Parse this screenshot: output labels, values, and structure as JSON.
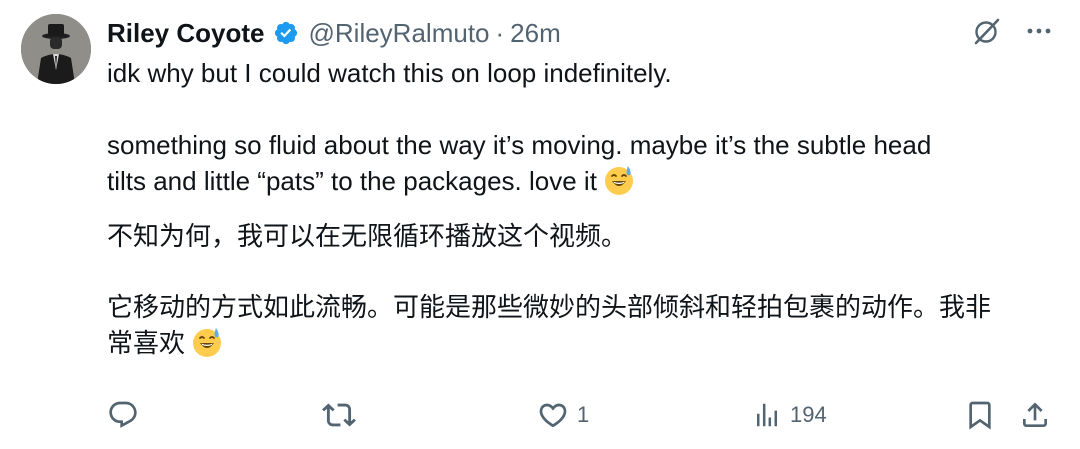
{
  "tweet": {
    "author": {
      "name": "Riley Coyote",
      "handle": "@RileyRalmuto",
      "separator": "·",
      "time": "26m",
      "avatar_icon": "avatar-figure-in-hat"
    },
    "verified_icon": "verified-badge-icon",
    "colors": {
      "accent": "#1d9bf0",
      "secondary_text": "#536471",
      "text": "#0f1419"
    },
    "lines": [
      "idk why but I could watch this on loop indefinitely.",
      "something so fluid about the way it’s moving. maybe it’s the subtle head",
      "tilts and little “pats” to the packages. love it",
      "不知为何，我可以在无限循环播放这个视频。",
      "它移动的方式如此流畅。可能是那些微妙的头部倾斜和轻拍包裹的动作。我非",
      "常喜欢"
    ],
    "emoji_icon": "grinning-face-with-sweat-emoji",
    "actions": {
      "reply": {
        "icon": "reply-icon",
        "count": ""
      },
      "repost": {
        "icon": "repost-icon",
        "count": ""
      },
      "like": {
        "icon": "heart-icon",
        "count": "1"
      },
      "views": {
        "icon": "views-chart-icon",
        "count": "194"
      },
      "bookmark": {
        "icon": "bookmark-icon"
      },
      "share": {
        "icon": "share-icon"
      }
    },
    "top_icons": [
      "grok-icon",
      "more-icon"
    ]
  }
}
